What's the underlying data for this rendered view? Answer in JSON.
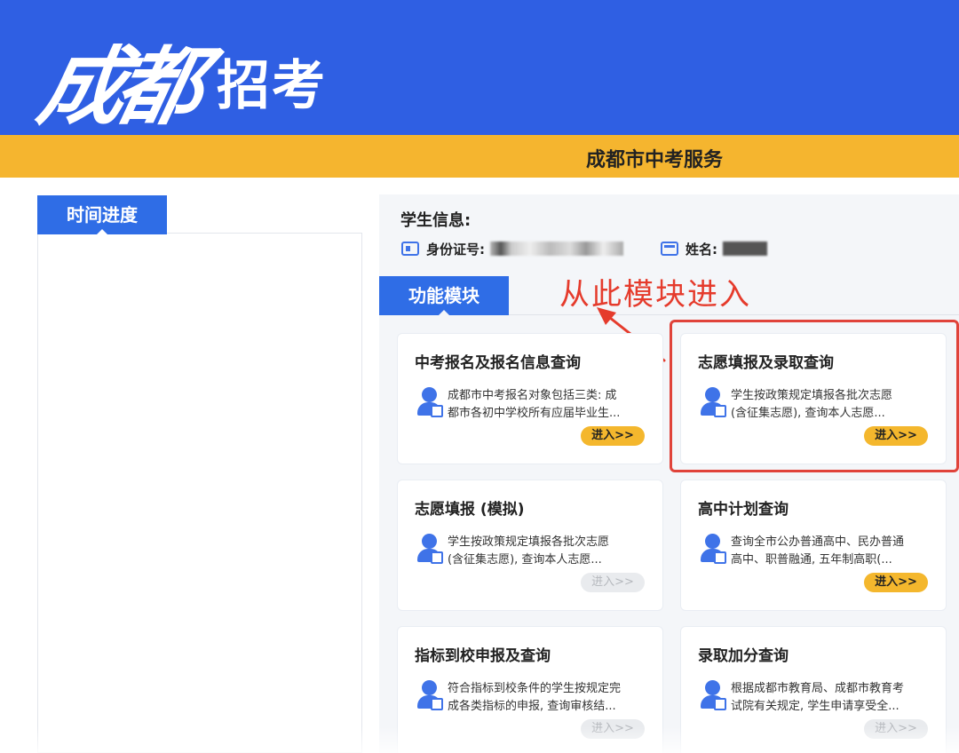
{
  "header": {
    "logo_cal": "成都",
    "logo_sub": "招考"
  },
  "banner": {
    "service": "成都市中考服务"
  },
  "left_panel": {
    "tab": "时间进度"
  },
  "student": {
    "title": "学生信息:",
    "id_label": "身份证号:",
    "name_label": "姓名:"
  },
  "func": {
    "tab": "功能模块"
  },
  "annotation": {
    "text": "从此模块进入"
  },
  "cards": [
    {
      "title": "中考报名及报名信息查询",
      "line1": "成都市中考报名对象包括三类: 成",
      "line2": "都市各初中学校所有应届毕业生...",
      "enter": "进入>>",
      "enabled": true
    },
    {
      "title": "志愿填报及录取查询",
      "line1": "学生按政策规定填报各批次志愿",
      "line2": "(含征集志愿), 查询本人志愿...",
      "enter": "进入>>",
      "enabled": true
    },
    {
      "title": "志愿填报 (模拟)",
      "line1": "学生按政策规定填报各批次志愿",
      "line2": "(含征集志愿), 查询本人志愿...",
      "enter": "进入>>",
      "enabled": false
    },
    {
      "title": "高中计划查询",
      "line1": "查询全市公办普通高中、民办普通",
      "line2": "高中、职普融通, 五年制高职(...",
      "enter": "进入>>",
      "enabled": true
    },
    {
      "title": "指标到校申报及查询",
      "line1": "符合指标到校条件的学生按规定完",
      "line2": "成各类指标的申报, 查询审核结...",
      "enter": "进入>>",
      "enabled": false
    },
    {
      "title": "录取加分查询",
      "line1": "根据成都市教育局、成都市教育考",
      "line2": "试院有关规定, 学生申请享受全...",
      "enter": "进入>>",
      "enabled": false
    }
  ],
  "colors": {
    "header_blue": "#2f5fe3",
    "banner_yellow": "#f5b52f",
    "tab_blue": "#2f6de6",
    "enter_yellow": "#f4b72d",
    "annotation_red": "#e53b2c"
  },
  "icons": [
    "id-card-icon",
    "calendar-icon",
    "student-doc-icon"
  ]
}
